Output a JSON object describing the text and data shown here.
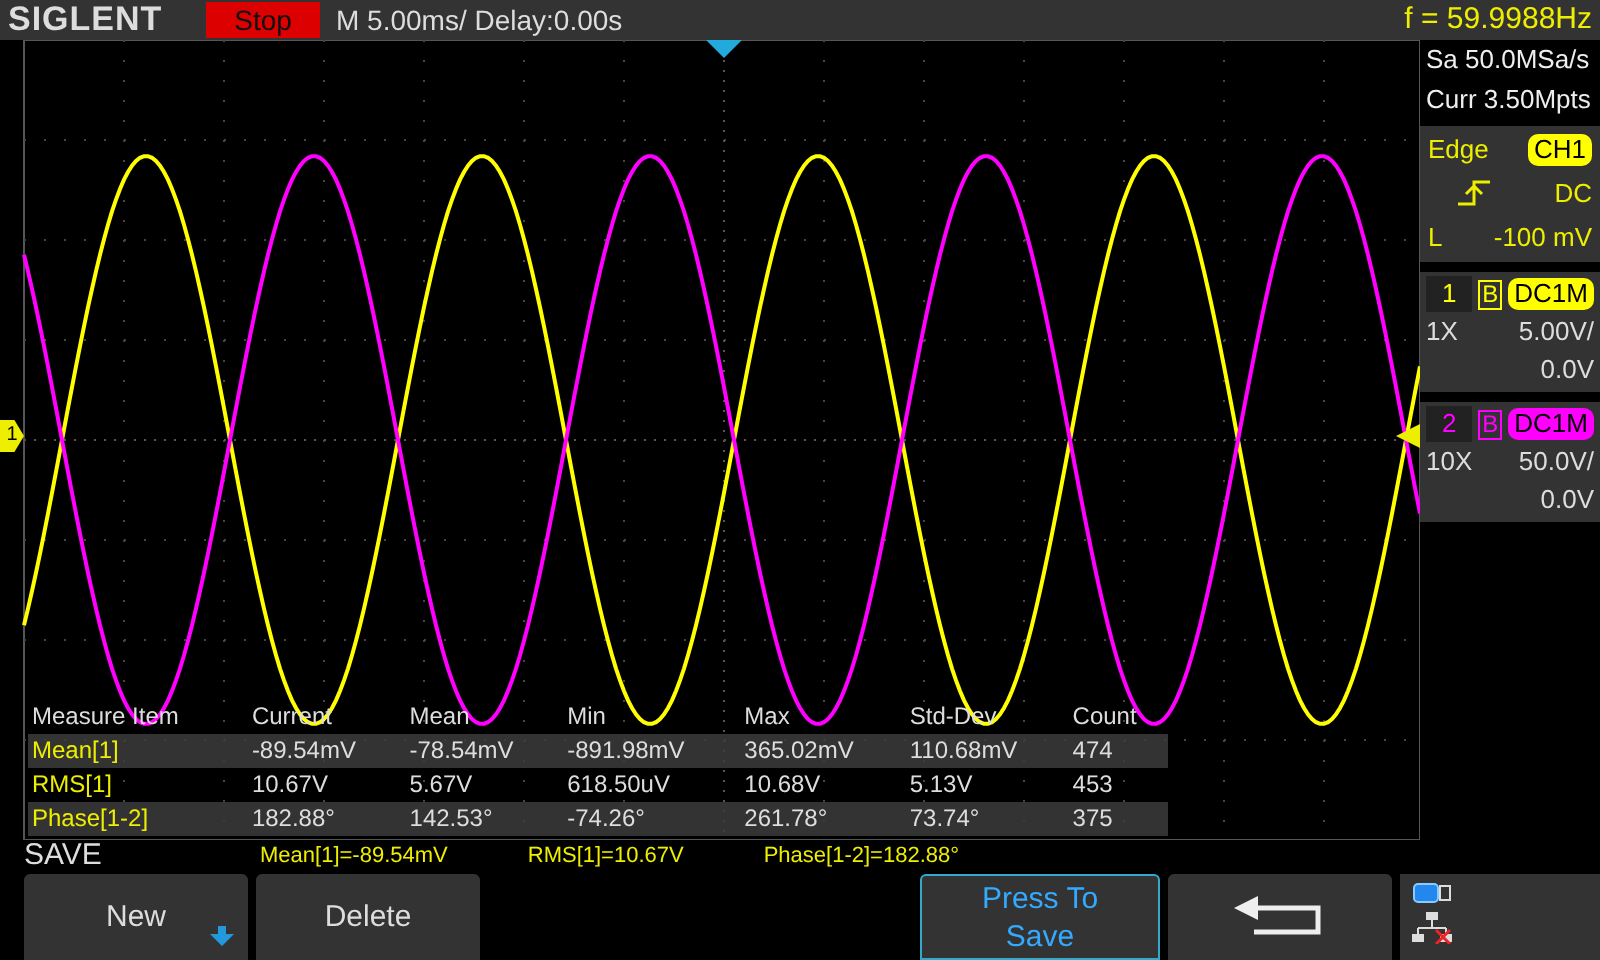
{
  "header": {
    "brand": "SIGLENT",
    "run_state": "Stop",
    "timebase": "M 5.00ms/ Delay:0.00s",
    "frequency": "f = 59.9988Hz"
  },
  "plot": {
    "ground_marker": "1"
  },
  "acquisition": {
    "sample_rate": "Sa 50.0MSa/s",
    "memory": "Curr 3.50Mpts"
  },
  "trigger": {
    "type": "Edge",
    "source": "CH1",
    "coupling": "DC",
    "level_label": "L",
    "level": "-100 mV"
  },
  "channels": [
    {
      "number": "1",
      "bw_limit": "B",
      "coupling": "DC1M",
      "probe": "1X",
      "scale": "5.00V/",
      "offset": "0.0V",
      "color": "#ffff00"
    },
    {
      "number": "2",
      "bw_limit": "B",
      "coupling": "DC1M",
      "probe": "10X",
      "scale": "50.0V/",
      "offset": "0.0V",
      "color": "#ff00ff"
    }
  ],
  "measure_table": {
    "columns": [
      "Measure Item",
      "Current",
      "Mean",
      "Min",
      "Max",
      "Std-Dev",
      "Count"
    ],
    "rows": [
      [
        "Mean[1]",
        "-89.54mV",
        "-78.54mV",
        "-891.98mV",
        "365.02mV",
        "110.68mV",
        "474"
      ],
      [
        "RMS[1]",
        "10.67V",
        "5.67V",
        "618.50uV",
        "10.68V",
        "5.13V",
        "453"
      ],
      [
        "Phase[1-2]",
        "182.88°",
        "142.53°",
        "-74.26°",
        "261.78°",
        "73.74°",
        "375"
      ]
    ]
  },
  "menu_title": "SAVE",
  "readouts": [
    "Mean[1]=-89.54mV",
    "RMS[1]=10.67V",
    "Phase[1-2]=182.88°"
  ],
  "softkeys": [
    {
      "kind": "dropdown",
      "label": "New",
      "selected": false
    },
    {
      "kind": "text",
      "label": "Delete",
      "selected": false
    },
    {
      "kind": "spacer"
    },
    {
      "kind": "text",
      "label": "Press To Save",
      "selected": true
    },
    {
      "kind": "back",
      "selected": false
    }
  ]
}
